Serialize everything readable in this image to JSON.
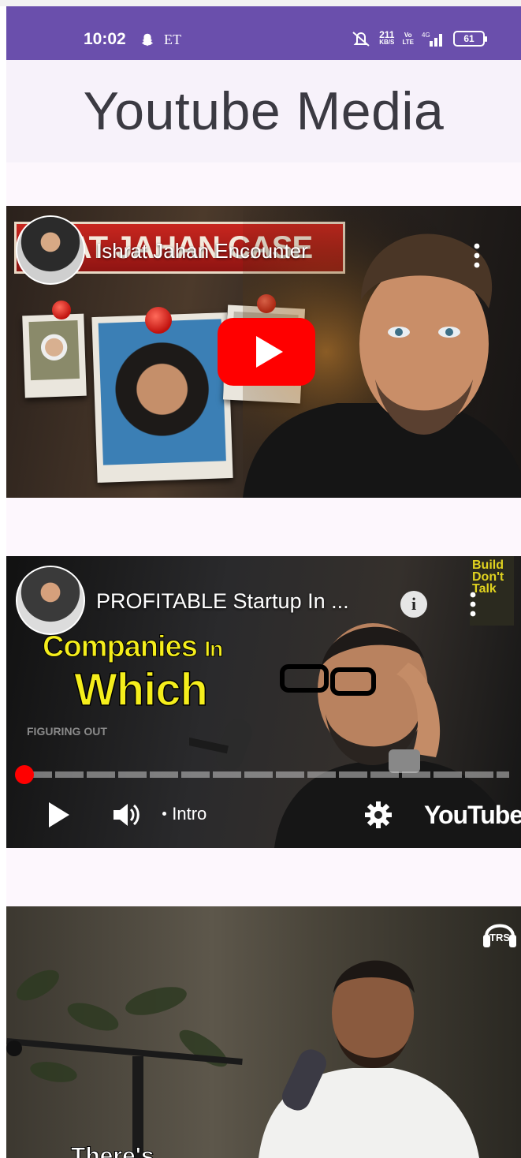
{
  "status_bar": {
    "time": "10:02",
    "carrier_text": "ET",
    "net_speed": "211",
    "net_speed_unit": "KB/S",
    "volte_line1": "Vo",
    "volte_line2": "LTE",
    "network": "4G",
    "battery": "61",
    "icons": [
      "snapchat-icon",
      "mute-icon",
      "signal-icon",
      "battery-icon"
    ],
    "background_color": "#6a4fac"
  },
  "app_bar": {
    "title": "Youtube Media",
    "background_color": "#f7f2fa"
  },
  "videos": [
    {
      "title": "Ishrat Jahan Encounter",
      "thumbnail_text": "RAT JAHAN CASE",
      "state": "thumbnail",
      "icons": [
        "channel-avatar",
        "more-vert-icon",
        "youtube-play-icon"
      ]
    },
    {
      "title": "PROFITABLE Startup In ...",
      "thumbnail_text_line1": "Companies",
      "thumbnail_text_line1_small": "In",
      "thumbnail_text_line2": "Which",
      "watermark": "FIGURING OUT",
      "book_text": "Build Don't Talk",
      "state": "playing-controls",
      "chapter": "Intro",
      "brand": "YouTube",
      "progress": 0.01,
      "icons": [
        "channel-avatar",
        "info-icon",
        "more-vert-icon",
        "play-icon",
        "volume-icon",
        "settings-icon"
      ]
    },
    {
      "logo_text": "TRS",
      "subtitle": "There's",
      "state": "thumbnail"
    }
  ],
  "accent_color": "#ff0000"
}
